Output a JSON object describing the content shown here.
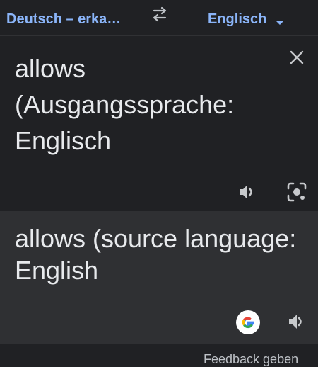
{
  "language_bar": {
    "source_language": "Deutsch – erka…",
    "target_language": "Englisch"
  },
  "source": {
    "text": "allows (Ausgangssprache: Englisch"
  },
  "translation": {
    "text": "allows (source language: English"
  },
  "footer": {
    "feedback_label": "Feedback geben"
  },
  "colors": {
    "accent": "#8ab4f8",
    "background": "#202124",
    "translation_background": "#2f3033",
    "text": "#e8eaed",
    "icon": "#c7c9cc"
  },
  "icons": {
    "swap": "swap-arrows-icon",
    "dropdown": "chevron-down-icon",
    "clear": "close-icon",
    "listen_source": "speaker-icon",
    "camera": "camera-lens-icon",
    "google": "google-logo-icon",
    "listen_translation": "speaker-icon"
  }
}
